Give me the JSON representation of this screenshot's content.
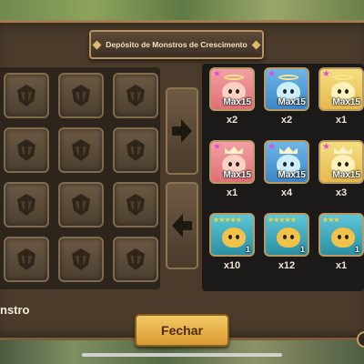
{
  "window": {
    "title": "Depósito de Monstros de Crescimento"
  },
  "storage": {
    "slot_count": 12
  },
  "monsters": [
    {
      "element": "fire",
      "marker": "★",
      "badge": "Max15",
      "count": "x2"
    },
    {
      "element": "water",
      "marker": "★",
      "badge": "Max15",
      "count": "x2"
    },
    {
      "element": "wind",
      "marker": "★",
      "badge": "Max15",
      "count": "x1"
    },
    {
      "element": "fire",
      "marker": "★",
      "badge": "Max15",
      "count": "x1"
    },
    {
      "element": "water",
      "marker": "★",
      "badge": "Max15",
      "count": "x4"
    },
    {
      "element": "wind",
      "marker": "★",
      "badge": "Max15",
      "count": "x3"
    },
    {
      "element": "teal",
      "marker": "★★★★★",
      "badge": "1",
      "count": "x10"
    },
    {
      "element": "teal",
      "marker": "★★★★★",
      "badge": "1",
      "count": "x12"
    },
    {
      "element": "teal",
      "marker": "★★★",
      "badge": "1",
      "count": "x1"
    }
  ],
  "footer": {
    "label": "nstro",
    "close_label": "Fechar"
  },
  "colors": {
    "panel": "#4a3b2b",
    "accent_gold": "#e0a847",
    "star_pink": "#e64bd6",
    "star_gold": "#f5d53a"
  }
}
